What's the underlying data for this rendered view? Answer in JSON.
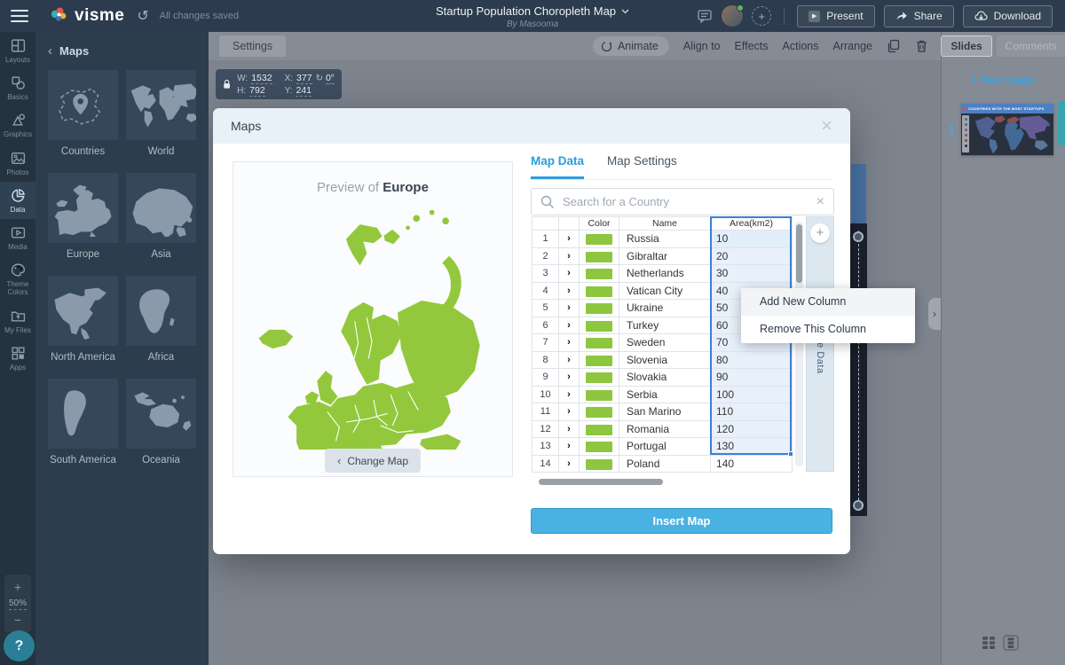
{
  "topbar": {
    "logo_text": "visme",
    "autosave": "All changes saved",
    "title": "Startup Population Choropleth Map",
    "byline": "By Masooma",
    "present_label": "Present",
    "share_label": "Share",
    "download_label": "Download"
  },
  "sidebar": {
    "items": [
      {
        "icon": "layouts-icon",
        "label": "Layouts",
        "active": false
      },
      {
        "icon": "basics-icon",
        "label": "Basics",
        "active": false
      },
      {
        "icon": "graphics-icon",
        "label": "Graphics",
        "active": false
      },
      {
        "icon": "photos-icon",
        "label": "Photos",
        "active": false
      },
      {
        "icon": "data-icon",
        "label": "Data",
        "active": true
      },
      {
        "icon": "media-icon",
        "label": "Media",
        "active": false
      },
      {
        "icon": "theme-colors-icon",
        "label": "Theme Colors",
        "active": false
      },
      {
        "icon": "my-files-icon",
        "label": "My Files",
        "active": false
      },
      {
        "icon": "apps-icon",
        "label": "Apps",
        "active": false
      }
    ]
  },
  "maps_panel": {
    "back_chevron": "‹",
    "title": "Maps",
    "tiles": [
      "Countries",
      "World",
      "Europe",
      "Asia",
      "North America",
      "Africa",
      "South America",
      "Oceania"
    ]
  },
  "canvas_toolbar": {
    "settings_label": "Settings",
    "animate_label": "Animate",
    "align_label": "Align to",
    "effects_label": "Effects",
    "actions_label": "Actions",
    "arrange_label": "Arrange"
  },
  "position_box": {
    "w_label": "W:",
    "w_value": "1532",
    "x_label": "X:",
    "x_value": "377",
    "rotation_value": "0°",
    "h_label": "H:",
    "h_value": "792",
    "y_label": "Y:",
    "y_value": "241"
  },
  "modal": {
    "title": "Maps",
    "close_glyph": "×",
    "preview_label": "Preview of",
    "preview_region": "Europe",
    "change_map_label": "Change Map",
    "tab_data": "Map Data",
    "tab_settings": "Map Settings",
    "search_placeholder": "Search for a Country",
    "clear_glyph": "×",
    "explore_label": "Explore Data",
    "add_glyph": "+",
    "insert_label": "Insert Map",
    "table": {
      "headers": [
        "Color",
        "Name",
        "Area(km2)"
      ],
      "row_arrow": "›",
      "swatch_color": "#8dc63f",
      "selection": {
        "selected_row_count": 13,
        "active_row": 1
      },
      "rows": [
        {
          "n": "1",
          "name": "Russia",
          "value": "10"
        },
        {
          "n": "2",
          "name": "Gibraltar",
          "value": "20"
        },
        {
          "n": "3",
          "name": "Netherlands",
          "value": "30"
        },
        {
          "n": "4",
          "name": "Vatican City",
          "value": "40"
        },
        {
          "n": "5",
          "name": "Ukraine",
          "value": "50"
        },
        {
          "n": "6",
          "name": "Turkey",
          "value": "60"
        },
        {
          "n": "7",
          "name": "Sweden",
          "value": "70"
        },
        {
          "n": "8",
          "name": "Slovenia",
          "value": "80"
        },
        {
          "n": "9",
          "name": "Slovakia",
          "value": "90"
        },
        {
          "n": "10",
          "name": "Serbia",
          "value": "100"
        },
        {
          "n": "11",
          "name": "San Marino",
          "value": "110"
        },
        {
          "n": "12",
          "name": "Romania",
          "value": "120"
        },
        {
          "n": "13",
          "name": "Portugal",
          "value": "130"
        },
        {
          "n": "14",
          "name": "Poland",
          "value": "140"
        }
      ]
    }
  },
  "context_menu": {
    "items": [
      {
        "label": "Add New Column",
        "highlighted": true
      },
      {
        "label": "Remove This Column",
        "highlighted": false
      }
    ]
  },
  "right_panel": {
    "tab_slides": "Slides",
    "tab_comments": "Comments",
    "new_page_label": "+ New page",
    "slide_number": "1",
    "slide_title": "COUNTRIES WITH THE MOST STARTUPS"
  },
  "zoom_control": {
    "zoom_in": "+",
    "level": "50%",
    "zoom_out": "−"
  },
  "help_label": "?",
  "colors": {
    "map_green": "#93c83d",
    "swatch_green": "#8dc63f",
    "accent_blue": "#2d9cdb",
    "insert_blue": "#49b2e2",
    "selection_blue": "#3b7fd8"
  }
}
